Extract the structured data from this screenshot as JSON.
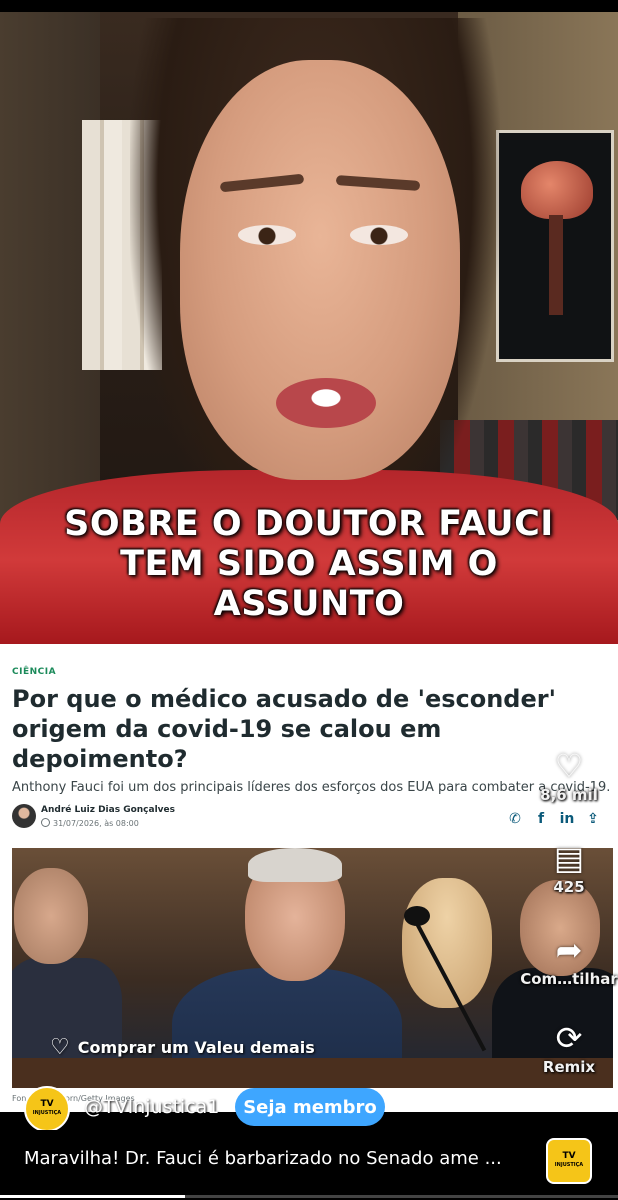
{
  "video": {
    "caption_lines": [
      "SOBRE O DOUTOR FAUCI",
      "TEM SIDO ASSIM O",
      "ASSUNTO"
    ]
  },
  "article": {
    "tag": "CIÊNCIA",
    "headline": "Por que o médico acusado de 'esconder' origem da covid-19 se calou em depoimento?",
    "lede": "Anthony Fauci foi um dos principais líderes dos esforços dos EUA para combater a covid-19.",
    "author": "André Luiz Dias Gonçalves",
    "date": "31/07/2026, às 08:00",
    "photo_credit": "Fon... Khunatorn/Getty Images",
    "share_icons": [
      "whatsapp-icon",
      "facebook-icon",
      "linkedin-icon",
      "share-icon"
    ]
  },
  "actions": {
    "likes": "8,6 mil",
    "comments": "425",
    "share_label": "Com…tilhar",
    "remix_label": "Remix"
  },
  "shop": {
    "label": "Comprar um Valeu demais"
  },
  "channel": {
    "name": "@TVInjustica1",
    "join_label": "Seja membro",
    "logo_line1": "TV",
    "logo_line2": "INJUSTIÇA"
  },
  "footer": {
    "title": "Maravilha! Dr. Fauci é barbarizado no Senado ame ...",
    "progress": 0.3
  },
  "colors": {
    "accent_blue": "#3ea6ff",
    "logo_yellow": "#f5c518",
    "shirt_red": "#c8302f",
    "tag_green": "#1b8a5a"
  }
}
